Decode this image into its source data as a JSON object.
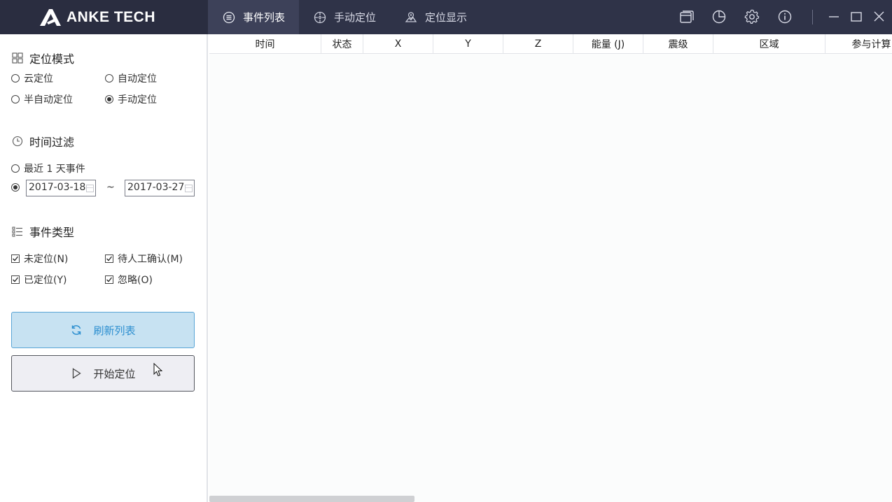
{
  "app": {
    "logo_text": "ANKE TECH"
  },
  "nav": {
    "tabs": [
      {
        "label": "事件列表",
        "icon": "list-icon",
        "active": true
      },
      {
        "label": "手动定位",
        "icon": "crosshair-icon",
        "active": false
      },
      {
        "label": "定位显示",
        "icon": "map-icon",
        "active": false
      }
    ]
  },
  "window_icons": [
    "cards-icon",
    "pie-chart-icon",
    "gear-icon",
    "info-icon",
    "minimize-icon",
    "maximize-icon",
    "close-icon"
  ],
  "sidebar": {
    "mode": {
      "title": "定位模式",
      "options": [
        {
          "label": "云定位",
          "selected": false
        },
        {
          "label": "自动定位",
          "selected": false
        },
        {
          "label": "半自动定位",
          "selected": false
        },
        {
          "label": "手动定位",
          "selected": true
        }
      ]
    },
    "time": {
      "title": "时间过滤",
      "recent_label": "最近 1 天事件",
      "recent_selected": false,
      "range_selected": true,
      "date_from": "2017-03-18",
      "date_to": "2017-03-27",
      "separator": "~"
    },
    "types": {
      "title": "事件类型",
      "options": [
        {
          "label": "未定位(N)",
          "checked": true
        },
        {
          "label": "待人工确认(M)",
          "checked": true
        },
        {
          "label": "已定位(Y)",
          "checked": true
        },
        {
          "label": "忽略(O)",
          "checked": true
        }
      ]
    },
    "refresh_label": "刷新列表",
    "start_label": "开始定位"
  },
  "table": {
    "columns": [
      "时间",
      "状态",
      "X",
      "Y",
      "Z",
      "能量 (J)",
      "震级",
      "区域",
      "参与计算台站"
    ],
    "rows": []
  },
  "colors": {
    "titlebar": "#2f3348",
    "active_tab": "#3d4159",
    "accent": "#2d8fd0",
    "refresh_bg": "#c7e2f2"
  }
}
